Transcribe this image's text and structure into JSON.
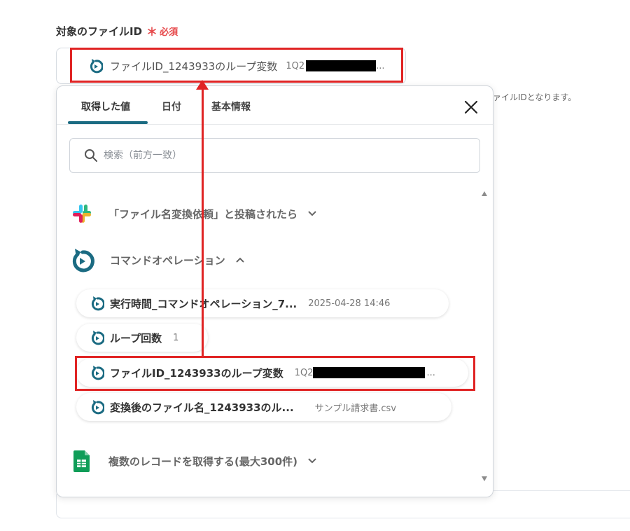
{
  "field": {
    "label": "対象のファイルID",
    "required_mark": "＊",
    "required_text": "必須",
    "value_label": "ファイルID_1243933のループ変数",
    "value_prefix": "1Q2",
    "value_ellipsis": "...",
    "help_text": "ァイルIDとなります。"
  },
  "popup": {
    "tabs": [
      {
        "label": "取得した値"
      },
      {
        "label": "日付"
      },
      {
        "label": "基本情報"
      }
    ],
    "search_placeholder": "検索（前方一致）",
    "sections": [
      {
        "label": "「ファイル名変換依頼」と投稿されたら",
        "icon": "slack-icon"
      },
      {
        "label": "コマンドオペレーション",
        "icon": "loop-icon"
      },
      {
        "label": "複数のレコードを取得する(最大300件)",
        "icon": "google-sheets-icon"
      }
    ],
    "items": [
      {
        "label": "実行時間_コマンドオペレーション_7...",
        "value": "2025-04-28 14:46"
      },
      {
        "label": "ループ回数",
        "value": "1"
      },
      {
        "label": "ファイルID_1243933のループ変数",
        "value": "1Q2",
        "value_ellipsis": "..."
      },
      {
        "label": "変換後のファイル名_1243933のル...",
        "value": "サンプル請求書.csv"
      }
    ]
  },
  "colors": {
    "accent": "#1b6b82",
    "required": "#e6484a",
    "annotation": "#e02424"
  }
}
